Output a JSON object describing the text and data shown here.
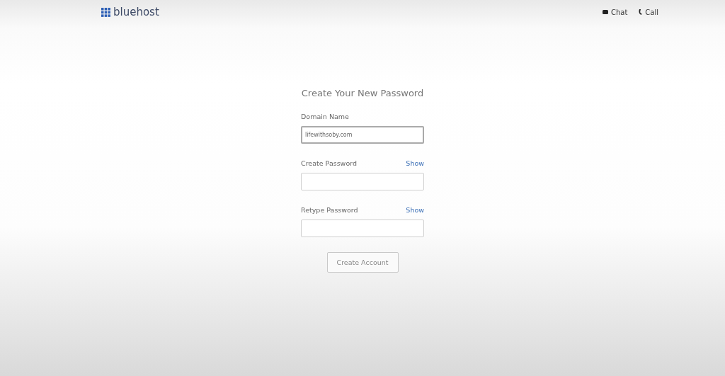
{
  "header": {
    "logo": "bluehost",
    "links": [
      {
        "kind": "chat",
        "label": "Chat"
      },
      {
        "kind": "call",
        "label": "Call"
      }
    ]
  },
  "form": {
    "title": "Create Your New Password",
    "fields": [
      {
        "label": "Domain Name",
        "value": "lifewithsoby.com",
        "focused": true
      },
      {
        "label": "Create Password",
        "toggle": "Show",
        "focused": false
      },
      {
        "label": "Retype Password",
        "toggle": "Show",
        "focused": false
      }
    ],
    "submit": "Create Account"
  }
}
